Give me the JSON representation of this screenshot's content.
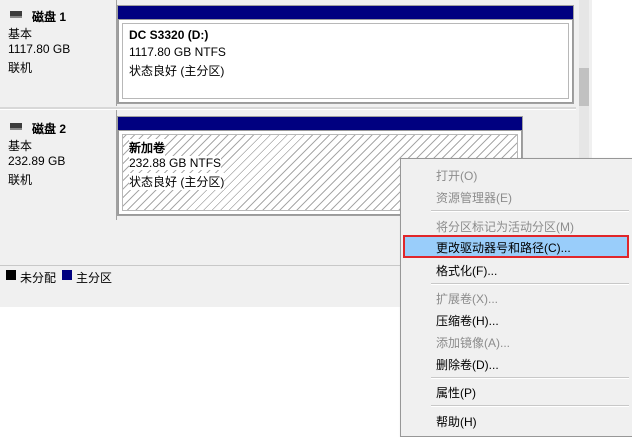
{
  "disks": [
    {
      "title": "磁盘 1",
      "type": "基本",
      "size": "1117.80 GB",
      "status": "联机",
      "volume": {
        "name": "DC S3320  (D:)",
        "size_fs": "1117.80 GB NTFS",
        "health": "状态良好 (主分区)"
      }
    },
    {
      "title": "磁盘 2",
      "type": "基本",
      "size": "232.89 GB",
      "status": "联机",
      "volume": {
        "name": "新加卷",
        "size_fs": "232.88 GB NTFS",
        "health": "状态良好 (主分区)"
      }
    }
  ],
  "legend": {
    "unallocated": "未分配",
    "primary": "主分区",
    "unallocated_color": "#000000",
    "primary_color": "#000080"
  },
  "context_menu": {
    "items": [
      {
        "label": "打开(O)",
        "enabled": false
      },
      {
        "label": "资源管理器(E)",
        "enabled": false
      },
      {
        "label": "将分区标记为活动分区(M)",
        "enabled": false
      },
      {
        "label": "更改驱动器号和路径(C)...",
        "enabled": true,
        "highlighted": true
      },
      {
        "label": "格式化(F)...",
        "enabled": true
      },
      {
        "label": "扩展卷(X)...",
        "enabled": false
      },
      {
        "label": "压缩卷(H)...",
        "enabled": true
      },
      {
        "label": "添加镜像(A)...",
        "enabled": false
      },
      {
        "label": "删除卷(D)...",
        "enabled": true
      },
      {
        "label": "属性(P)",
        "enabled": true
      },
      {
        "label": "帮助(H)",
        "enabled": true
      }
    ],
    "highlight_color": "#99cdfa",
    "highlight_border": "#e0262a"
  }
}
